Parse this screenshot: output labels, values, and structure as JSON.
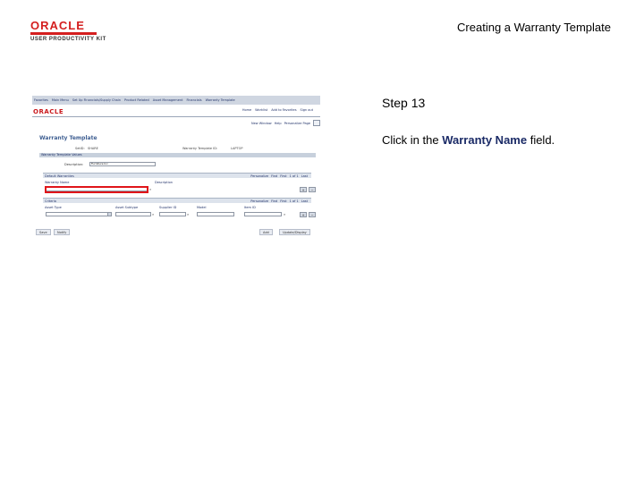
{
  "header": {
    "logo_text": "ORACLE",
    "logo_subtitle": "USER PRODUCTIVITY KIT",
    "doc_title": "Creating a Warranty Template"
  },
  "screenshot": {
    "nav_items": [
      "Favorites",
      "Main Menu",
      "Set Up Financials/Supply Chain",
      "Product Related",
      "Asset Management",
      "Financials",
      "Warranty Template"
    ],
    "brand": "ORACLE",
    "top_links": [
      "Home",
      "Worklist",
      "Add to Favorites",
      "Sign out"
    ],
    "util_links": [
      "New Window",
      "Help",
      "Personalize Page"
    ],
    "page_title": "Warranty Template",
    "setid_label": "SetID:",
    "setid_value": "SHARE",
    "template_id_label": "Warranty Template ID:",
    "template_id_value": "LAPTOP",
    "section_title": "Warranty Template Values",
    "description_label": "Description:",
    "description_value": "Furniture Inc",
    "grid1": {
      "title": "Default Warranties",
      "controls": [
        "Personalize",
        "Find",
        "First",
        "1 of 1",
        "Last"
      ],
      "columns": [
        "Warranty Name",
        "Description"
      ]
    },
    "grid2": {
      "title": "Criteria",
      "controls": [
        "Personalize",
        "Find",
        "First",
        "1 of 1",
        "Last"
      ],
      "columns": [
        "Asset Type",
        "Asset Subtype",
        "Supplier ID",
        "Model",
        "Item ID"
      ]
    },
    "buttons": [
      "Save",
      "Notify",
      "Add",
      "Update/Display"
    ]
  },
  "instruction": {
    "step": "Step 13",
    "prefix": "Click in the ",
    "target": "Warranty Name",
    "suffix": " field."
  },
  "colors": {
    "oracle_red": "#d41f1f",
    "highlight_red": "#e0151a",
    "nav_blue": "#cfd6e1"
  }
}
